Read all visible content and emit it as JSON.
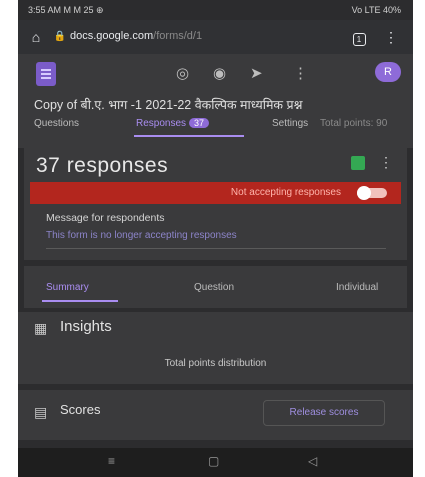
{
  "status": {
    "left": "3:55 AM M M 25 ⊕",
    "right": "Vo LTE 40%"
  },
  "browser": {
    "url_main": "docs.google.com",
    "url_rest": "/forms/d/1",
    "tab_count": "1",
    "home_glyph": "⌂",
    "lock_glyph": "🔒",
    "menu_glyph": "⋮"
  },
  "form": {
    "title": "Copy of बी.ए. भाग -1 2021-22 वैकल्पिक माध्यमिक प्रश्न",
    "tabs": [
      {
        "label": "Questions"
      },
      {
        "label": "Responses"
      },
      {
        "label": "Settings"
      }
    ],
    "response_badge": "37",
    "total_points": "Total points: 90",
    "tool_icons": [
      "palette-icon",
      "preview-icon",
      "send-icon",
      "more-vert-icon"
    ],
    "avatar_letter": "R"
  },
  "responses": {
    "count_label": "37 responses",
    "accepting_label": "Not accepting responses",
    "message_label": "Message for respondents",
    "message_text": "This form is no longer accepting responses"
  },
  "subtabs": [
    {
      "label": "Summary"
    },
    {
      "label": "Question"
    },
    {
      "label": "Individual"
    }
  ],
  "insights": {
    "title": "Insights",
    "subtitle": "Total points distribution"
  },
  "scores": {
    "title": "Scores",
    "button": "Release scores"
  },
  "colors": {
    "accent": "#a98df0",
    "danger": "#b3261e",
    "surface": "#3a3a3c"
  }
}
